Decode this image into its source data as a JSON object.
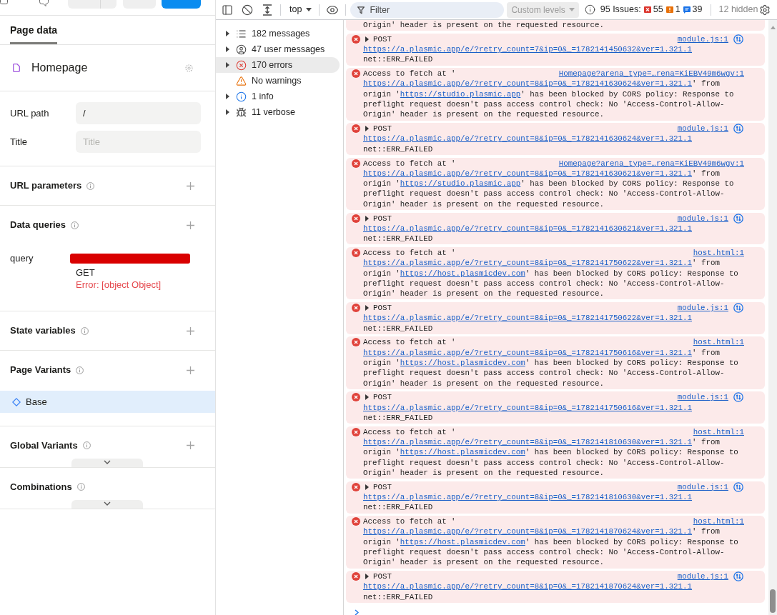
{
  "editor": {
    "tabs": [
      {
        "label": "Page data",
        "selected": true
      }
    ],
    "page": {
      "name": "Homepage"
    },
    "fields": [
      {
        "label": "URL path",
        "value": "/"
      },
      {
        "label": "Title",
        "placeholder": "Title"
      }
    ],
    "sections": [
      {
        "kind": "plain",
        "title": "URL parameters",
        "can_add": true
      },
      {
        "kind": "queries",
        "title": "Data queries",
        "can_add": true,
        "queries": [
          {
            "label": "query",
            "method": "GET",
            "error": "Error: [object Object]"
          }
        ]
      },
      {
        "kind": "plain",
        "title": "State variables",
        "can_add": true
      },
      {
        "kind": "variants",
        "title": "Page Variants",
        "can_add": true,
        "variants": [
          {
            "label": "Base",
            "selected": true
          }
        ]
      },
      {
        "kind": "collapsible",
        "title": "Global Variants",
        "can_add": true
      },
      {
        "kind": "collapsible",
        "title": "Combinations",
        "can_add": false
      }
    ]
  },
  "devtools": {
    "toolbar": {
      "context": "top",
      "filter": {
        "placeholder": "Filter"
      },
      "levels": {
        "label": "Custom levels",
        "disabled": true
      },
      "issues": {
        "label": "95 Issues:",
        "counts": [
          {
            "kind": "error",
            "count": "55"
          },
          {
            "kind": "warning",
            "count": "1"
          },
          {
            "kind": "info",
            "count": "39"
          }
        ]
      },
      "hidden": "12 hidden"
    },
    "sidebar": [
      {
        "kind": "messages",
        "label": "182 messages",
        "expandable": true,
        "selected": false
      },
      {
        "kind": "user",
        "label": "47 user messages",
        "expandable": true,
        "selected": false
      },
      {
        "kind": "error",
        "label": "170 errors",
        "expandable": true,
        "selected": true
      },
      {
        "kind": "warning",
        "label": "No warnings",
        "expandable": false,
        "selected": false
      },
      {
        "kind": "info",
        "label": "1 info",
        "expandable": true,
        "selected": false
      },
      {
        "kind": "verbose",
        "label": "11 verbose",
        "expandable": true,
        "selected": false
      }
    ],
    "messages": [
      {
        "kind": "tail",
        "text": "Origin' header is present on the requested resource."
      },
      {
        "kind": "request",
        "method": "POST",
        "url": "https://a.plasmic.app/e/?retry_count=7&ip=0&_=1782141450632&ver=1.321.1",
        "status": "net::ERR_FAILED",
        "source": "module.js:1"
      },
      {
        "kind": "cors",
        "prefix": "Access to fetch at '",
        "url": "https://a.plasmic.app/e/?retry_count=8&ip=0&_=1782141630624&ver=1.321.1",
        "middle": "' from origin '",
        "origin": "https://studio.plasmic.app",
        "rest": "' has been blocked by CORS policy: Response to preflight request doesn't pass access control check: No 'Access-Control-Allow-Origin' header is present on the requested resource.",
        "source": "Homepage?arena_type=…rena=KiEBV49m6wgv:1"
      },
      {
        "kind": "request",
        "method": "POST",
        "url": "https://a.plasmic.app/e/?retry_count=8&ip=0&_=1782141630624&ver=1.321.1",
        "status": "net::ERR_FAILED",
        "source": "module.js:1"
      },
      {
        "kind": "cors",
        "prefix": "Access to fetch at '",
        "url": "https://a.plasmic.app/e/?retry_count=8&ip=0&_=1782141630621&ver=1.321.1",
        "middle": "' from origin '",
        "origin": "https://studio.plasmic.app",
        "rest": "' has been blocked by CORS policy: Response to preflight request doesn't pass access control check: No 'Access-Control-Allow-Origin' header is present on the requested resource.",
        "source": "Homepage?arena_type=…rena=KiEBV49m6wgv:1"
      },
      {
        "kind": "request",
        "method": "POST",
        "url": "https://a.plasmic.app/e/?retry_count=8&ip=0&_=1782141630621&ver=1.321.1",
        "status": "net::ERR_FAILED",
        "source": "module.js:1"
      },
      {
        "kind": "cors",
        "prefix": "Access to fetch at '",
        "url": "https://a.plasmic.app/e/?retry_count=8&ip=0&_=1782141750622&ver=1.321.1",
        "middle": "' from origin '",
        "origin": "https://host.plasmicdev.com",
        "rest": "' has been blocked by CORS policy: Response to preflight request doesn't pass access control check: No 'Access-Control-Allow-Origin' header is present on the requested resource.",
        "source": "host.html:1"
      },
      {
        "kind": "request",
        "method": "POST",
        "url": "https://a.plasmic.app/e/?retry_count=8&ip=0&_=1782141750622&ver=1.321.1",
        "status": "net::ERR_FAILED",
        "source": "module.js:1"
      },
      {
        "kind": "cors",
        "prefix": "Access to fetch at '",
        "url": "https://a.plasmic.app/e/?retry_count=8&ip=0&_=1782141750616&ver=1.321.1",
        "middle": "' from origin '",
        "origin": "https://host.plasmicdev.com",
        "rest": "' has been blocked by CORS policy: Response to preflight request doesn't pass access control check: No 'Access-Control-Allow-Origin' header is present on the requested resource.",
        "source": "host.html:1"
      },
      {
        "kind": "request",
        "method": "POST",
        "url": "https://a.plasmic.app/e/?retry_count=8&ip=0&_=1782141750616&ver=1.321.1",
        "status": "net::ERR_FAILED",
        "source": "module.js:1"
      },
      {
        "kind": "cors",
        "prefix": "Access to fetch at '",
        "url": "https://a.plasmic.app/e/?retry_count=8&ip=0&_=1782141810630&ver=1.321.1",
        "middle": "' from origin '",
        "origin": "https://host.plasmicdev.com",
        "rest": "' has been blocked by CORS policy: Response to preflight request doesn't pass access control check: No 'Access-Control-Allow-Origin' header is present on the requested resource.",
        "source": "host.html:1"
      },
      {
        "kind": "request",
        "method": "POST",
        "url": "https://a.plasmic.app/e/?retry_count=8&ip=0&_=1782141810630&ver=1.321.1",
        "status": "net::ERR_FAILED",
        "source": "module.js:1"
      },
      {
        "kind": "cors",
        "prefix": "Access to fetch at '",
        "url": "https://a.plasmic.app/e/?retry_count=8&ip=0&_=1782141870624&ver=1.321.1",
        "middle": "' from origin '",
        "origin": "https://host.plasmicdev.com",
        "rest": "' has been blocked by CORS policy: Response to preflight request doesn't pass access control check: No 'Access-Control-Allow-Origin' header is present on the requested resource.",
        "source": "host.html:1"
      },
      {
        "kind": "request",
        "method": "POST",
        "url": "https://a.plasmic.app/e/?retry_count=8&ip=0&_=1782141870624&ver=1.321.1",
        "status": "net::ERR_FAILED",
        "source": "module.js:1"
      }
    ]
  }
}
